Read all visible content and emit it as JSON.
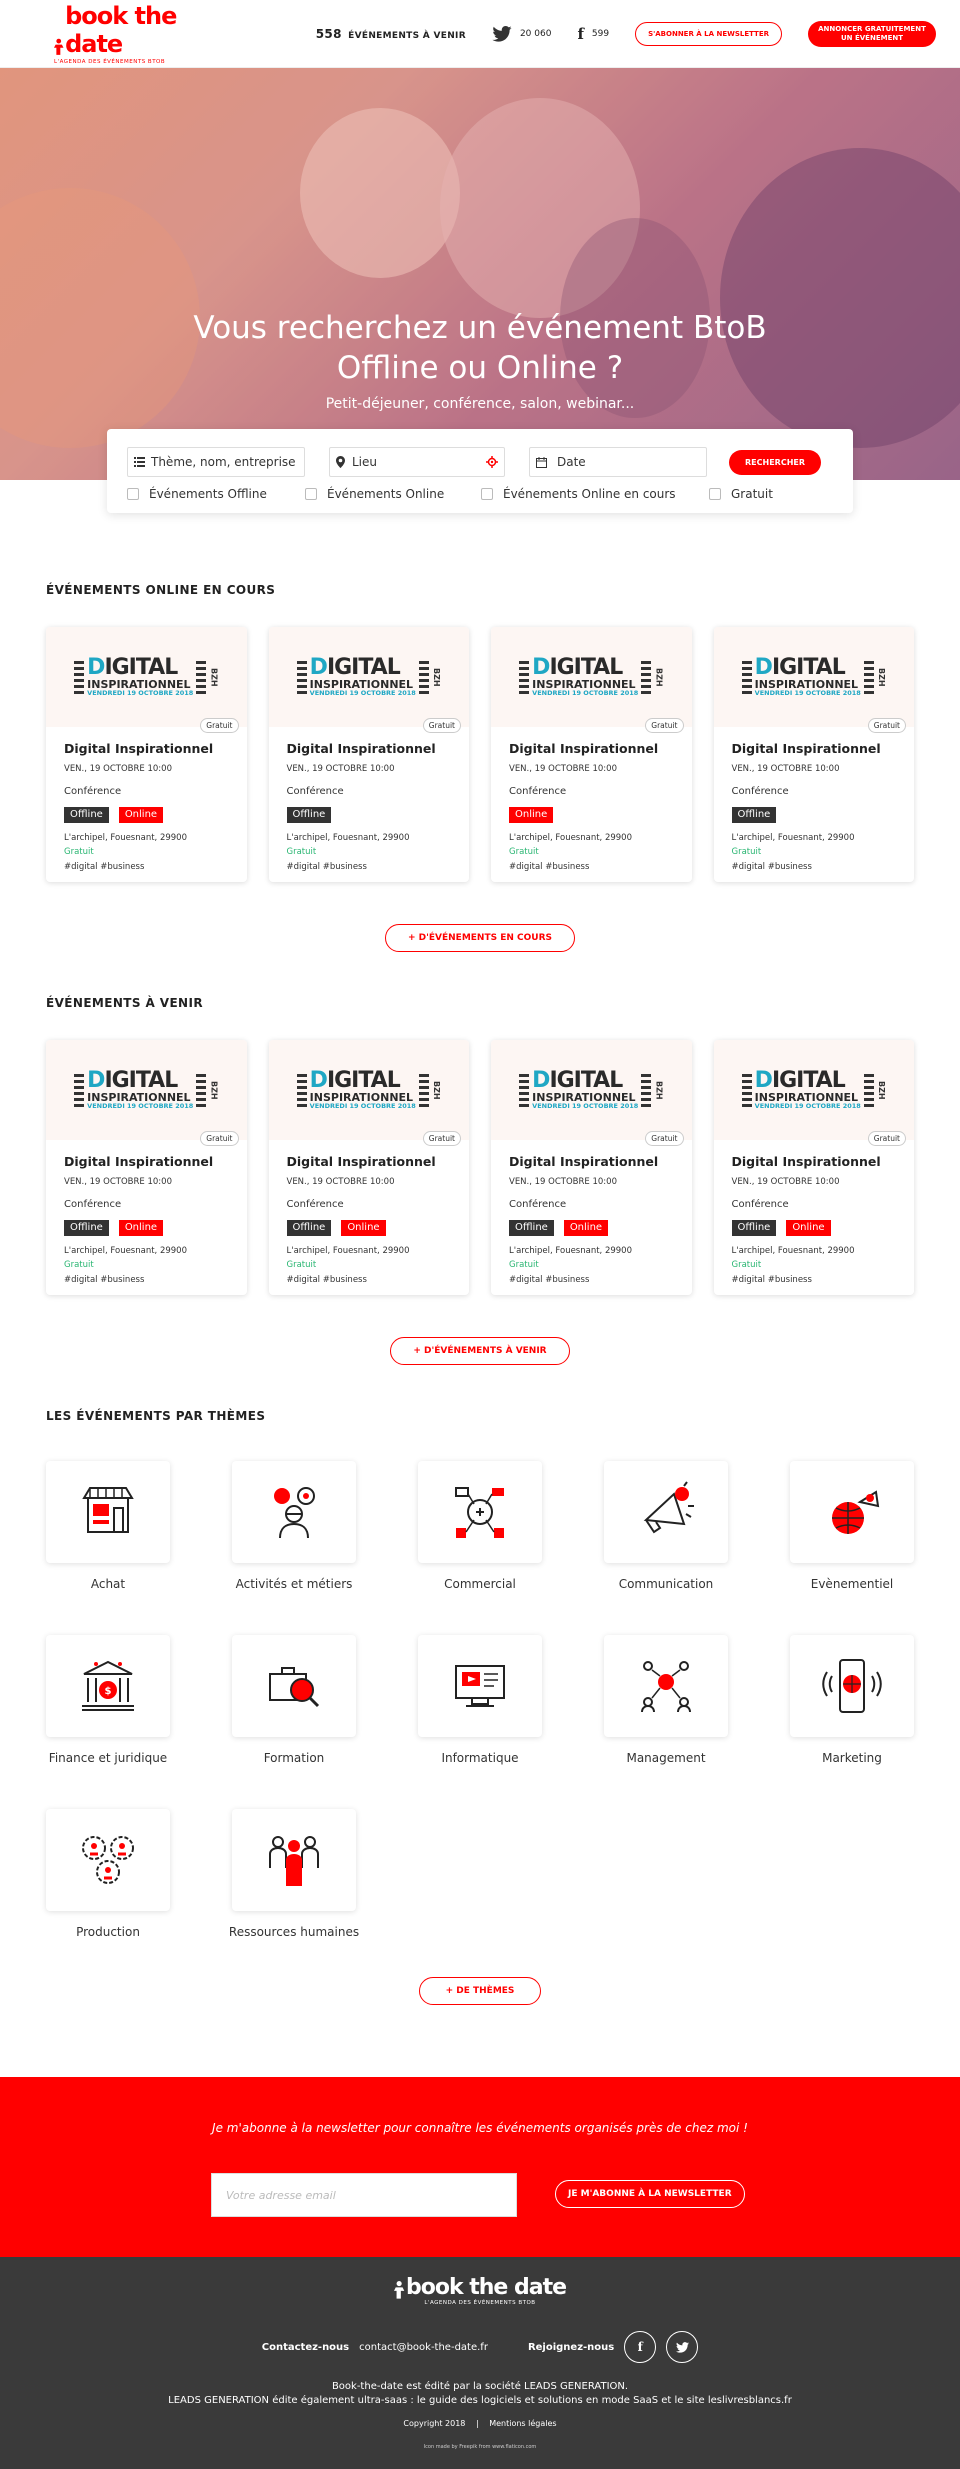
{
  "header": {
    "logo_text": "book the date",
    "logo_sub": "L'AGENDA DES ÉVÉNEMENTS BTOB",
    "events_count": "558",
    "events_label": "ÉVÉNEMENTS À VENIR",
    "twitter_count": "20 060",
    "facebook_count": "599",
    "newsletter_btn": "S'ABONNER À LA NEWSLETTER",
    "announce_btn_line1": "ANNONCER GRATUITEMENT",
    "announce_btn_line2": "UN ÉVÉNEMENT"
  },
  "hero": {
    "title_line1": "Vous recherchez un événement BtoB",
    "title_line2": "Offline ou Online ?",
    "tagline": "Petit-déjeuner, conférence, salon, webinar..."
  },
  "search": {
    "theme_placeholder": "Thème, nom, entreprise",
    "place_placeholder": "Lieu",
    "date_placeholder": "Date",
    "submit": "RECHERCHER",
    "filters": [
      "Événements Offline",
      "Événements Online",
      "Événements Online en cours",
      "Gratuit"
    ]
  },
  "online_section": {
    "title": "ÉVÉNEMENTS ONLINE EN COURS",
    "more_btn": "+ D'ÉVÉNEMENTS EN COURS",
    "cards": [
      {
        "title": "Digital Inspirationnel",
        "date": "VEN., 19 OCTOBRE 10:00",
        "type": "Conférence",
        "offline": "Offline",
        "online": "Online",
        "location": "L'archipel, Fouesnant, 29900",
        "price": "Gratuit",
        "hashtags": "#digital #business",
        "badge": "Gratuit"
      },
      {
        "title": "Digital Inspirationnel",
        "date": "VEN., 19 OCTOBRE 10:00",
        "type": "Conférence",
        "offline": "Offline",
        "online": "",
        "location": "L'archipel, Fouesnant, 29900",
        "price": "Gratuit",
        "hashtags": "#digital #business",
        "badge": "Gratuit"
      },
      {
        "title": "Digital Inspirationnel",
        "date": "VEN., 19 OCTOBRE 10:00",
        "type": "Conférence",
        "offline": "",
        "online": "Online",
        "location": "L'archipel, Fouesnant, 29900",
        "price": "Gratuit",
        "hashtags": "#digital #business",
        "badge": "Gratuit"
      },
      {
        "title": "Digital Inspirationnel",
        "date": "VEN., 19 OCTOBRE 10:00",
        "type": "Conférence",
        "offline": "Offline",
        "online": "",
        "location": "L'archipel, Fouesnant, 29900",
        "price": "Gratuit",
        "hashtags": "#digital #business",
        "badge": "Gratuit"
      }
    ]
  },
  "upcoming_section": {
    "title": "ÉVÉNEMENTS À VENIR",
    "more_btn": "+ D'ÉVÉNEMENTS À VENIR",
    "cards": [
      {
        "title": "Digital Inspirationnel",
        "date": "VEN., 19 OCTOBRE 10:00",
        "type": "Conférence",
        "offline": "Offline",
        "online": "Online",
        "location": "L'archipel, Fouesnant, 29900",
        "price": "Gratuit",
        "hashtags": "#digital #business",
        "badge": "Gratuit"
      },
      {
        "title": "Digital Inspirationnel",
        "date": "VEN., 19 OCTOBRE 10:00",
        "type": "Conférence",
        "offline": "Offline",
        "online": "Online",
        "location": "L'archipel, Fouesnant, 29900",
        "price": "Gratuit",
        "hashtags": "#digital #business",
        "badge": "Gratuit"
      },
      {
        "title": "Digital Inspirationnel",
        "date": "VEN., 19 OCTOBRE 10:00",
        "type": "Conférence",
        "offline": "Offline",
        "online": "Online",
        "location": "L'archipel, Fouesnant, 29900",
        "price": "Gratuit",
        "hashtags": "#digital #business",
        "badge": "Gratuit"
      },
      {
        "title": "Digital Inspirationnel",
        "date": "VEN., 19 OCTOBRE 10:00",
        "type": "Conférence",
        "offline": "Offline",
        "online": "Online",
        "location": "L'archipel, Fouesnant, 29900",
        "price": "Gratuit",
        "hashtags": "#digital #business",
        "badge": "Gratuit"
      }
    ]
  },
  "card_image": {
    "word_d": "D",
    "word_rest": "IGITAL",
    "word2": "INSPIRATIONNEL",
    "date": "VENDREDI 19 OCTOBRE 2018",
    "vertical": "BZH"
  },
  "themes_section": {
    "title": "LES ÉVÉNEMENTS PAR THÈMES",
    "more_btn": "+ DE THÈMES",
    "items": [
      {
        "label": "Achat",
        "icon": "shop-icon"
      },
      {
        "label": "Activités et métiers",
        "icon": "worker-gears-icon"
      },
      {
        "label": "Commercial",
        "icon": "sales-network-icon"
      },
      {
        "label": "Communication",
        "icon": "megaphone-icon"
      },
      {
        "label": "Evènementiel",
        "icon": "globe-megaphone-icon"
      },
      {
        "label": "Finance et juridique",
        "icon": "bank-icon"
      },
      {
        "label": "Formation",
        "icon": "briefcase-search-icon"
      },
      {
        "label": "Informatique",
        "icon": "computer-video-icon"
      },
      {
        "label": "Management",
        "icon": "team-network-icon"
      },
      {
        "label": "Marketing",
        "icon": "smartphone-globe-icon"
      },
      {
        "label": "Production",
        "icon": "gears-people-icon"
      },
      {
        "label": "Ressources humaines",
        "icon": "people-group-icon"
      }
    ]
  },
  "newsletter": {
    "text": "Je m'abonne à la newsletter pour connaître les événements organisés près de chez moi !",
    "placeholder": "Votre adresse email",
    "button": "JE M'ABONNE À LA NEWSLETTER"
  },
  "footer": {
    "logo_text": "book the date",
    "logo_sub": "L'AGENDA DES ÉVÉNEMENTS BTOB",
    "contact_label": "Contactez-nous",
    "contact_email": "contact@book-the-date.fr",
    "join_label": "Rejoignez-nous",
    "info_line1": "Book-the-date est édité par la société LEADS GENERATION.",
    "info_line2": "LEADS GENERATION édite également ultra-saas : le guide des logiciels et solutions en mode SaaS et le site leslivresblancs.fr",
    "copyright": "Copyright 2018",
    "legal": "Mentions légales",
    "credit": "Icon made by Freepik from www.flaticon.com"
  },
  "colors": {
    "brand": "#ff0000",
    "dark": "#333333",
    "free": "#2bb673",
    "digital_accent": "#1fa7c4"
  }
}
